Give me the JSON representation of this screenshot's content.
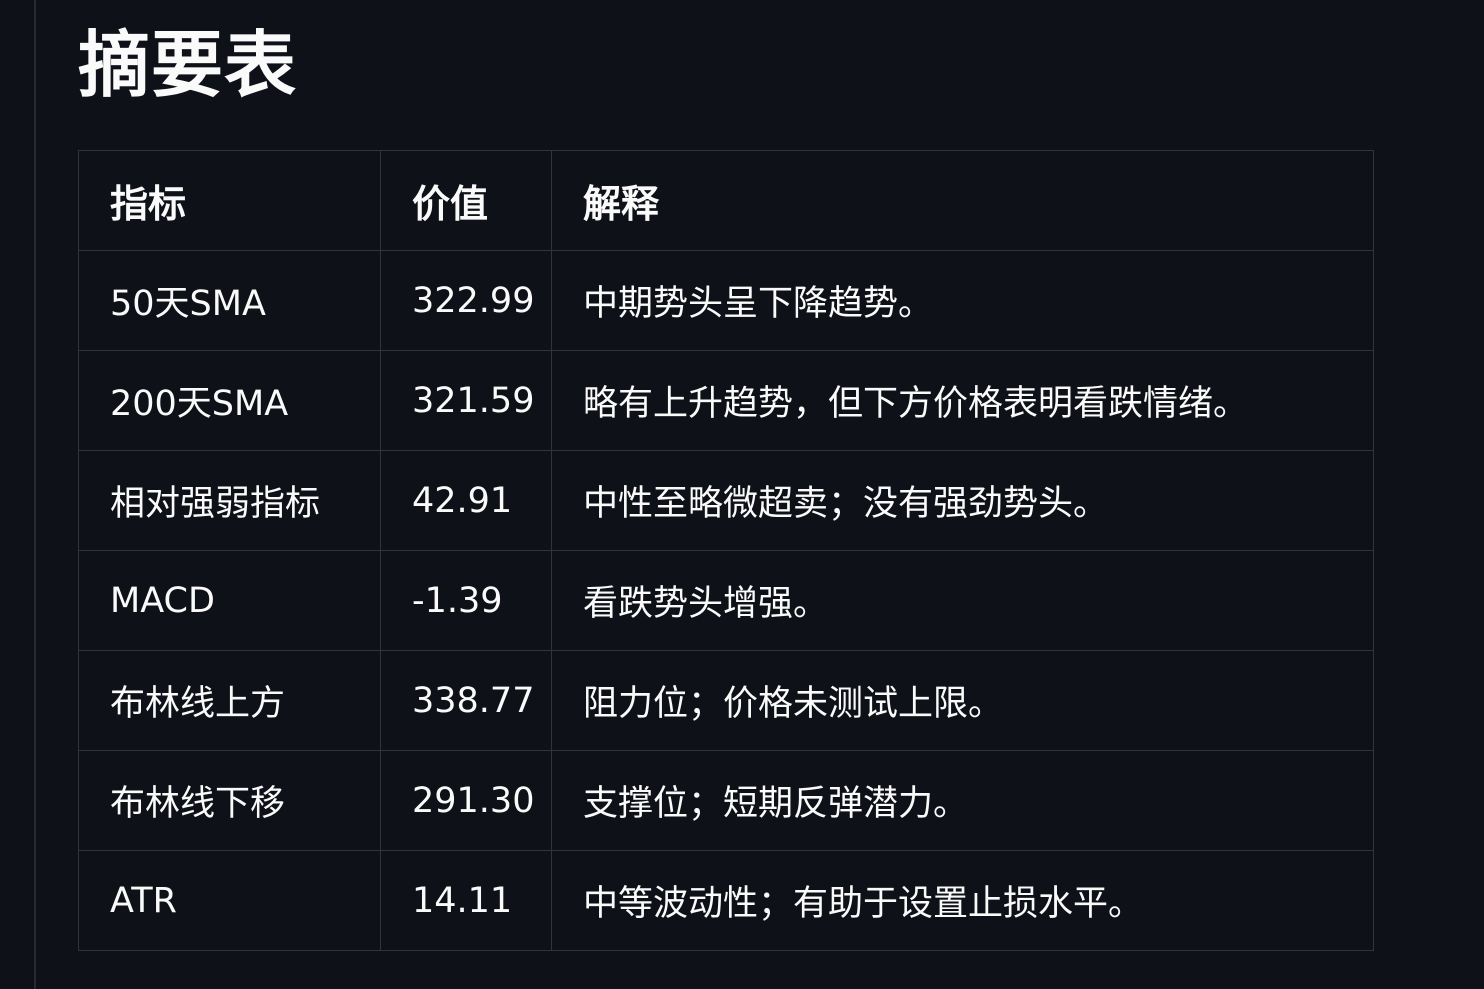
{
  "page": {
    "title": "摘要表"
  },
  "table": {
    "headers": [
      "指标",
      "价值",
      "解释"
    ],
    "rows": [
      [
        "50天SMA",
        "322.99",
        "中期势头呈下降趋势。"
      ],
      [
        "200天SMA",
        "321.59",
        "略有上升趋势，但下方价格表明看跌情绪。"
      ],
      [
        "相对强弱指标",
        "42.91",
        "中性至略微超卖；没有强劲势头。"
      ],
      [
        "MACD",
        "-1.39",
        "看跌势头增强。"
      ],
      [
        "布林线上方",
        "338.77",
        "阻力位；价格未测试上限。"
      ],
      [
        "布林线下移",
        "291.30",
        "支撑位；短期反弹潜力。"
      ],
      [
        "ATR",
        "14.11",
        "中等波动性；有助于设置止损水平。"
      ]
    ]
  },
  "colors": {
    "background": "#0e1117",
    "text": "#fafafa",
    "border": "#30343d"
  }
}
